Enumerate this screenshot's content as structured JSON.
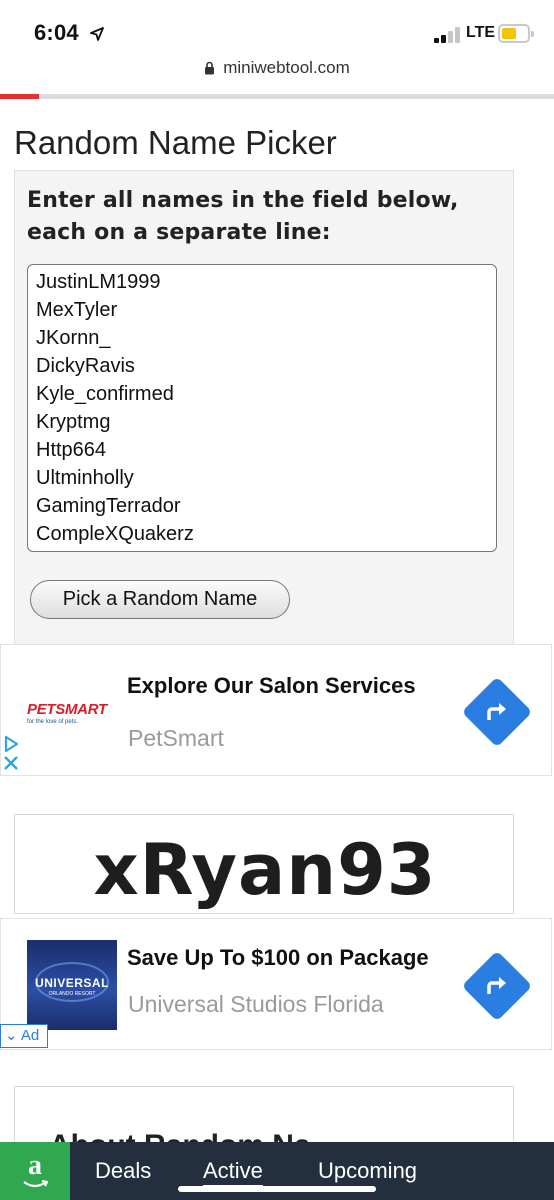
{
  "status_bar": {
    "time": "6:04",
    "network": "LTE",
    "battery_color": "#f5c400"
  },
  "browser": {
    "url": "miniwebtool.com",
    "load_progress": 0.07,
    "progress_color": "#e2322f"
  },
  "page": {
    "title": "Random Name Picker",
    "instructions": "Enter all names in the field below, each on a separate line:",
    "names": [
      "JustinLM1999",
      "MexTyler",
      "JKornn_",
      "DickyRavis",
      "Kyle_confirmed",
      "Kryptmg",
      "Http664",
      "Ultminholly",
      "GamingTerrador",
      "CompleXQuakerz"
    ],
    "pick_button": "Pick a Random Name",
    "result": "xRyan93",
    "about_heading": "About Random Na"
  },
  "ads": {
    "ad1": {
      "logo_text": "PETSMART",
      "logo_tagline": "for the love of pets.",
      "title": "Explore Our Salon Services",
      "source": "PetSmart"
    },
    "ad2": {
      "logo_text": "UNIVERSAL",
      "logo_sub": "ORLANDO RESORT",
      "title": "Save Up To $100 on Package",
      "source": "Universal Studios Florida",
      "ad_label": "Ad"
    },
    "accent_color": "#2a7de1"
  },
  "amazon_bar": {
    "logo_letter": "a",
    "tabs": [
      {
        "label": "Deals",
        "active": false
      },
      {
        "label": "Active",
        "active": true
      },
      {
        "label": "Upcoming",
        "active": false
      }
    ],
    "bar_color": "#232f3e",
    "logo_bg": "#2fa84f"
  }
}
